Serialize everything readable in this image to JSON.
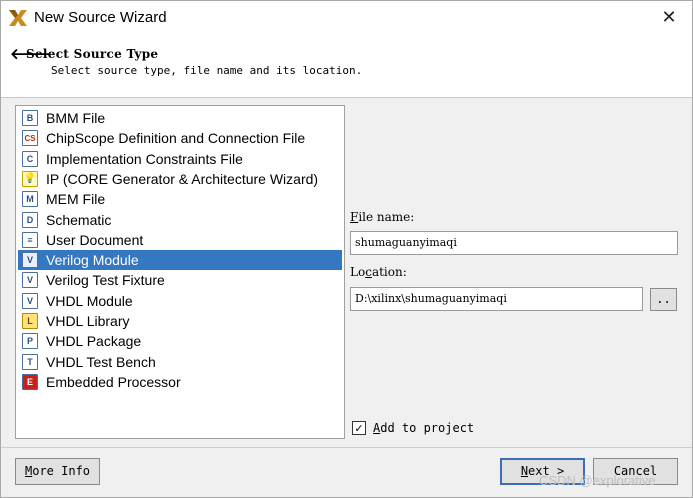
{
  "window": {
    "title": "New Source Wizard",
    "close_glyph": "✕"
  },
  "header": {
    "back_glyph": "🡐",
    "title": "Select Source Type",
    "subtitle": "Select source type, file name and its location."
  },
  "source_types": [
    {
      "label": "BMM File",
      "icon": "bmm-file-icon",
      "glyph": "B"
    },
    {
      "label": "ChipScope Definition and Connection File",
      "icon": "chipscope-icon",
      "glyph": "CS"
    },
    {
      "label": "Implementation Constraints File",
      "icon": "constraints-file-icon",
      "glyph": "C"
    },
    {
      "label": "IP (CORE Generator & Architecture Wizard)",
      "icon": "ip-core-icon",
      "glyph": "💡"
    },
    {
      "label": "MEM File",
      "icon": "mem-file-icon",
      "glyph": "M"
    },
    {
      "label": "Schematic",
      "icon": "schematic-icon",
      "glyph": "D"
    },
    {
      "label": "User Document",
      "icon": "user-document-icon",
      "glyph": "≡"
    },
    {
      "label": "Verilog Module",
      "icon": "verilog-module-icon",
      "glyph": "V",
      "selected": true
    },
    {
      "label": "Verilog Test Fixture",
      "icon": "verilog-test-fixture-icon",
      "glyph": "V"
    },
    {
      "label": "VHDL Module",
      "icon": "vhdl-module-icon",
      "glyph": "V"
    },
    {
      "label": "VHDL Library",
      "icon": "vhdl-library-icon",
      "glyph": "L"
    },
    {
      "label": "VHDL Package",
      "icon": "vhdl-package-icon",
      "glyph": "P"
    },
    {
      "label": "VHDL Test Bench",
      "icon": "vhdl-test-bench-icon",
      "glyph": "T"
    },
    {
      "label": "Embedded Processor",
      "icon": "embedded-processor-icon",
      "glyph": "E"
    }
  ],
  "form": {
    "file_name_label_u": "F",
    "file_name_label_rest": "ile name:",
    "file_name_value": "shumaguanyimaqi",
    "location_label_pre": "Lo",
    "location_label_u": "c",
    "location_label_rest": "ation:",
    "location_value": "D:\\xilinx\\shumaguanyimaqi",
    "browse_label": "..",
    "add_to_project_u": "A",
    "add_to_project_rest": "dd to project",
    "add_to_project_checked": "✓"
  },
  "buttons": {
    "more_info_u": "M",
    "more_info_rest": "ore Info",
    "next_u": "N",
    "next_rest": "ext >",
    "cancel": "Cancel"
  },
  "watermark": "CSDN @explorative",
  "colors": {
    "selection": "#3378c0",
    "window_bg": "#f0f0f0"
  }
}
